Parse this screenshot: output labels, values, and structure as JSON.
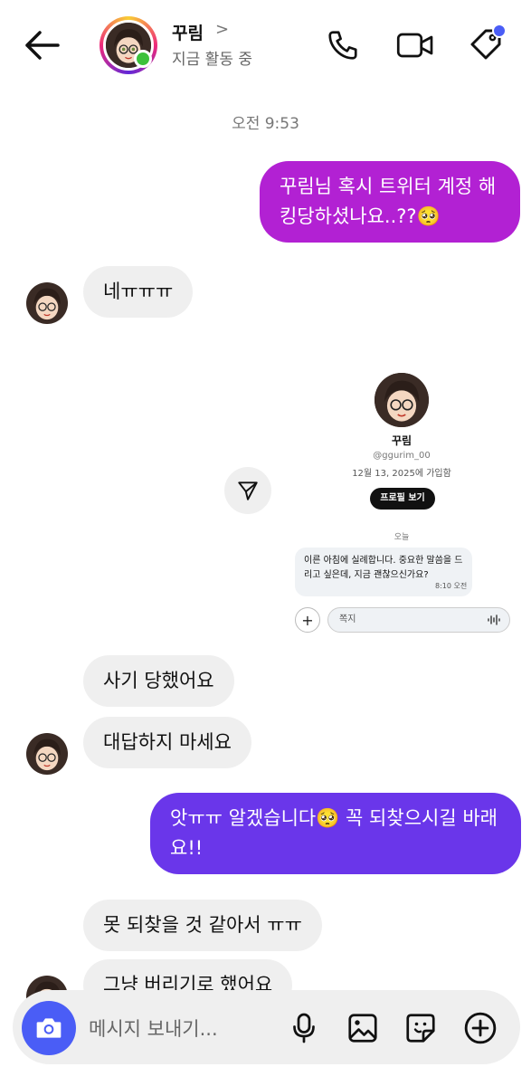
{
  "header": {
    "name": "꾸림",
    "status": "지금 활동 중",
    "chevron": ">"
  },
  "timestamp": "오전 9:53",
  "messages": {
    "m1": "꾸림님 혹시 트위터 계정 해킹당하셨나요..??🥺",
    "m2": "네ㅠㅠㅠ",
    "m3": "사기 당했어요",
    "m4": "대답하지 마세요",
    "m5": "앗ㅠㅠ 알겠습니다🥺 꼭 되찾으시길 바래요!!",
    "m6": "못 되찾을 것 같아서 ㅠㅠ",
    "m7": "그냥 버리기로 했어요"
  },
  "shared_image": {
    "profile_name": "꾸림",
    "handle": "@ggurim_00",
    "joined": "12월 13, 2025에 가입함",
    "profile_button": "프로필 보기",
    "day_label": "오늘",
    "dm_text": "이른 아침에 실례합니다. 중요한 말씀을 드리고 싶은데, 지금 괜찮으신가요?",
    "dm_time": "8:10 오전",
    "input_placeholder": "쪽지"
  },
  "composer": {
    "placeholder": "메시지 보내기..."
  },
  "colors": {
    "outgoing_purple": "#b221d3",
    "outgoing_indigo": "#6a36ea",
    "incoming_bg": "#efefef",
    "camera_button": "#4a5df6",
    "online": "#3cc13b"
  }
}
